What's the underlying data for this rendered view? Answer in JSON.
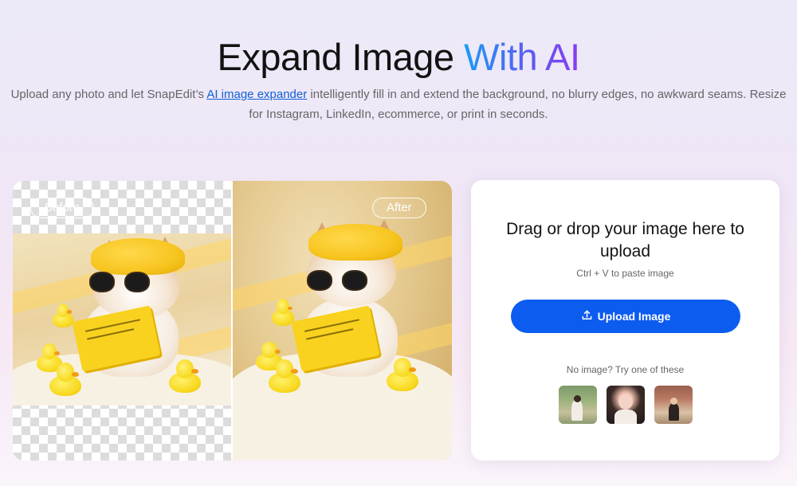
{
  "hero": {
    "title_main": "Expand Image ",
    "title_accent": "With AI",
    "desc_before": "Upload any photo and let SnapEdit’s ",
    "desc_link": "AI image expander",
    "desc_after": " intelligently fill in and extend the background, no blurry edges, no awkward seams. Resize for Instagram, LinkedIn, ecommerce, or print in seconds."
  },
  "compare": {
    "before_label": "Before",
    "after_label": "After"
  },
  "upload": {
    "title": "Drag or drop your image here to upload",
    "paste_hint": "Ctrl + V to paste image",
    "button_label": "Upload Image",
    "button_icon": "upload-icon",
    "samples_label": "No image? Try one of these",
    "samples": [
      "sample-image-1",
      "sample-image-2",
      "sample-image-3"
    ]
  },
  "colors": {
    "accent_blue": "#0c5cf0",
    "link": "#1060d8",
    "gradient_start": "#1a9cf5",
    "gradient_end": "#8a3cf0"
  }
}
